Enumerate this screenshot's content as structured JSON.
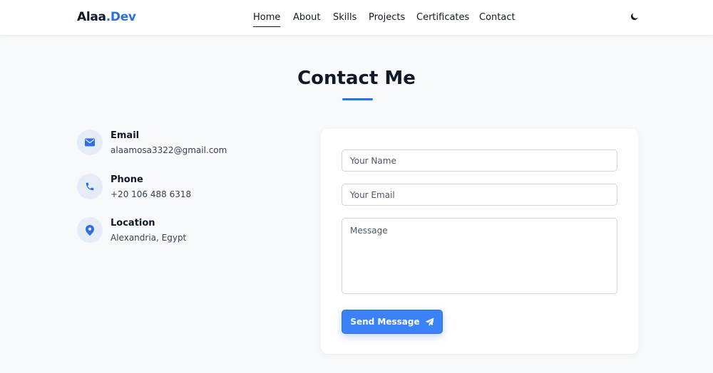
{
  "header": {
    "logo_part1": "Alaa",
    "logo_part2": ".Dev",
    "nav": {
      "home": "Home",
      "about": "About",
      "skills": "Skills",
      "projects": "Projects",
      "certificates": "Certificates",
      "contact": "Contact"
    },
    "active_nav": "Home",
    "theme_icon": "moon-icon"
  },
  "section": {
    "title": "Contact Me"
  },
  "contact_info": {
    "email": {
      "label": "Email",
      "value": "alaamosa3322@gmail.com",
      "icon": "envelope-icon"
    },
    "phone": {
      "label": "Phone",
      "value": "+20 106 488 6318",
      "icon": "phone-icon"
    },
    "location": {
      "label": "Location",
      "value": "Alexandria, Egypt",
      "icon": "map-pin-icon"
    }
  },
  "form": {
    "name_placeholder": "Your Name",
    "email_placeholder": "Your Email",
    "message_placeholder": "Message",
    "submit_label": "Send Message",
    "submit_icon": "paper-plane-icon"
  },
  "colors": {
    "accent": "#3b82f6",
    "brand_blue": "#2f6fe0",
    "background": "#f8f9fb",
    "icon_circle": "#e5ecf8"
  }
}
